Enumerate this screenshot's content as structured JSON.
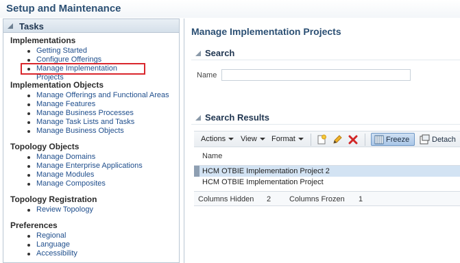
{
  "app": {
    "title": "Setup and Maintenance"
  },
  "tasks": {
    "header": "Tasks",
    "sections": [
      {
        "title": "Implementations",
        "items": [
          "Getting Started",
          "Configure Offerings",
          "Manage Implementation Projects"
        ]
      },
      {
        "title": "Implementation Objects",
        "items": [
          "Manage Offerings and Functional Areas",
          "Manage Features",
          "Manage Business Processes",
          "Manage Task Lists and Tasks",
          "Manage Business Objects"
        ]
      },
      {
        "title": "Topology Objects",
        "items": [
          "Manage Domains",
          "Manage Enterprise Applications",
          "Manage Modules",
          "Manage Composites"
        ]
      },
      {
        "title": "Topology Registration",
        "items": [
          "Review Topology"
        ]
      },
      {
        "title": "Preferences",
        "items": [
          "Regional",
          "Language",
          "Accessibility"
        ]
      }
    ],
    "highlighted_item": "Manage Implementation Projects"
  },
  "main": {
    "title": "Manage Implementation Projects",
    "search": {
      "header": "Search",
      "name_label": "Name",
      "name_value": ""
    },
    "results": {
      "header": "Search Results",
      "toolbar": {
        "actions": "Actions",
        "view": "View",
        "format": "Format",
        "freeze": "Freeze",
        "detach": "Detach"
      },
      "columns": [
        "Name"
      ],
      "rows": [
        "HCM OTBIE Implementation Project 2",
        "HCM OTBIE Implementation Project"
      ],
      "selected_row": 0,
      "summary": {
        "hidden_label": "Columns Hidden",
        "hidden_value": "2",
        "frozen_label": "Columns Frozen",
        "frozen_value": "1"
      }
    }
  },
  "colors": {
    "accent": "#2b4f73",
    "link": "#1f4e8c",
    "highlight_box": "#d9262c",
    "selected_row": "#d3e3f3"
  }
}
